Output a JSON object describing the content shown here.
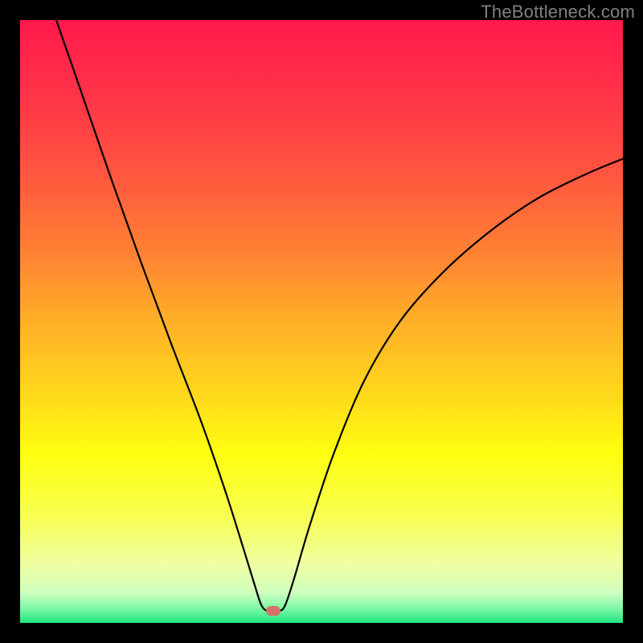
{
  "watermark": "TheBottleneck.com",
  "colors": {
    "marker": "#d8706a",
    "curve": "#000000",
    "gradient_stops": [
      {
        "offset": 0.0,
        "color": "#ff1a4d"
      },
      {
        "offset": 0.12,
        "color": "#ff3348"
      },
      {
        "offset": 0.25,
        "color": "#ff5540"
      },
      {
        "offset": 0.38,
        "color": "#ff8034"
      },
      {
        "offset": 0.5,
        "color": "#ffb028"
      },
      {
        "offset": 0.62,
        "color": "#ffd81c"
      },
      {
        "offset": 0.72,
        "color": "#ffff10"
      },
      {
        "offset": 0.82,
        "color": "#f8ff50"
      },
      {
        "offset": 0.9,
        "color": "#f0ffa0"
      },
      {
        "offset": 0.95,
        "color": "#d0ffc0"
      },
      {
        "offset": 0.975,
        "color": "#80f8a8"
      },
      {
        "offset": 1.0,
        "color": "#20e880"
      }
    ]
  },
  "chart_data": {
    "type": "line",
    "title": "",
    "xlabel": "",
    "ylabel": "",
    "xlim": [
      0,
      100
    ],
    "ylim": [
      0,
      100
    ],
    "marker": {
      "x": 42.0,
      "y": 2.0
    },
    "curve_points": [
      {
        "x": 6.0,
        "y": 100.0
      },
      {
        "x": 10.0,
        "y": 88.5
      },
      {
        "x": 15.0,
        "y": 74.0
      },
      {
        "x": 20.0,
        "y": 60.0
      },
      {
        "x": 25.0,
        "y": 46.5
      },
      {
        "x": 30.0,
        "y": 33.5
      },
      {
        "x": 34.0,
        "y": 22.0
      },
      {
        "x": 37.0,
        "y": 12.5
      },
      {
        "x": 39.0,
        "y": 6.0
      },
      {
        "x": 40.0,
        "y": 3.0
      },
      {
        "x": 41.0,
        "y": 2.0
      },
      {
        "x": 43.0,
        "y": 2.0
      },
      {
        "x": 44.0,
        "y": 3.0
      },
      {
        "x": 45.5,
        "y": 7.5
      },
      {
        "x": 48.0,
        "y": 16.0
      },
      {
        "x": 52.0,
        "y": 28.0
      },
      {
        "x": 57.0,
        "y": 40.0
      },
      {
        "x": 63.0,
        "y": 50.0
      },
      {
        "x": 70.0,
        "y": 58.0
      },
      {
        "x": 78.0,
        "y": 65.0
      },
      {
        "x": 86.0,
        "y": 70.5
      },
      {
        "x": 94.0,
        "y": 74.5
      },
      {
        "x": 100.0,
        "y": 77.0
      }
    ]
  }
}
